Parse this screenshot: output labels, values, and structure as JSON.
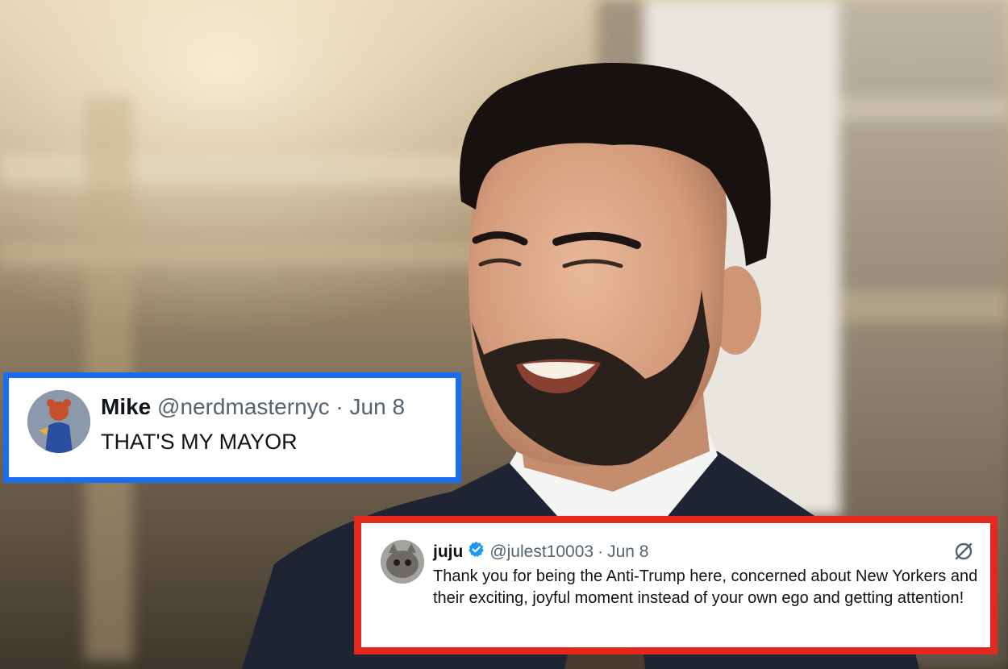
{
  "tweets": [
    {
      "name": "Mike",
      "handle": "@nerdmasternyc",
      "separator": "·",
      "date": "Jun 8",
      "text": "THAT'S MY MAYOR",
      "border_color": "#1a6cf0",
      "avatar_icon": "cartoon-character-avatar"
    },
    {
      "name": "juju",
      "handle": "@julest10003",
      "separator": "·",
      "date": "Jun 8",
      "verified": true,
      "verified_color": "#1d9bf0",
      "text": "Thank you for being the Anti-Trump here, concerned about New Yorkers and their exciting, joyful moment instead of your own ego and getting attention!",
      "border_color": "#e3291f",
      "avatar_icon": "cat-avatar",
      "action_icon": "grok-icon"
    }
  ]
}
